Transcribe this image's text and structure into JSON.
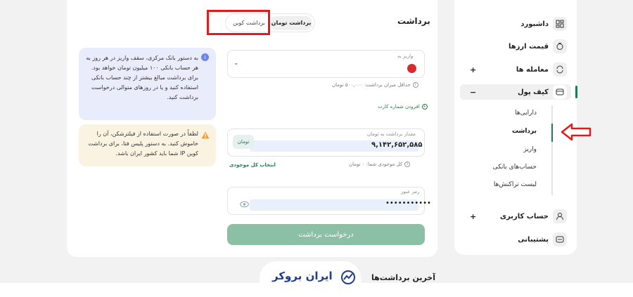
{
  "sidebar": {
    "items": [
      {
        "label": "داشبورد",
        "icon": "dashboard-icon"
      },
      {
        "label": "قیمت ارزها",
        "icon": "coin-icon"
      },
      {
        "label": "معامله ها",
        "icon": "trade-icon",
        "expand": "+"
      },
      {
        "label": "کیف پول",
        "icon": "wallet-icon",
        "expand": "−"
      },
      {
        "label": "حساب کاربری",
        "icon": "user-icon",
        "expand": "+"
      },
      {
        "label": "پشتیبانی",
        "icon": "support-icon"
      }
    ],
    "wallet_sub": [
      "دارایی‌ها",
      "برداشت",
      "واریز",
      "حساب‌های بانکی",
      "لیست تراکنش‌ها"
    ]
  },
  "main": {
    "title": "برداشت",
    "tabs": [
      "برداشت تومان",
      "برداشت کوین"
    ],
    "deposit_to_label": "واریز به",
    "min_withdraw_hint": "حداقل میزان برداشت: ۵۰۰,۰۰۰ تومان",
    "add_card": "افزودن شماره کارت",
    "amount_label": "مقدار برداشت به تومان",
    "amount_value": "۹,۱۴۲,۶۵۲,۵۸۵",
    "currency_badge": "تومان",
    "balance_hint": "کل موجودی شما: ۰ تومان",
    "select_all": "انتخاب کل موجودی",
    "password_label": "رمز عبور",
    "password_value": "•••••••••••",
    "submit": "درخواست برداشت",
    "info_text": "به دستور بانک مرکزی، سقف واریز در هر روز به هر حساب بانکی ۱۰۰ میلیون تومان خواهد بود. برای برداشت مبالغ بیشتر از چند حساب بانکی استفاده کنید و یا در روزهای متوالی درخواست برداشت کنید.",
    "warn_text": "لطفاً در صورت استفاده از فیلترشکن، آن را خاموش کنید. به دستور پلیس فتا، برای برداشت کوین IP شما باید کشور ایران باشد."
  },
  "recent": {
    "title": "آخرین برداشت‌ها"
  },
  "brand": {
    "logo": "ایران بروکر"
  },
  "colors": {
    "accent": "#1f7a4d",
    "submit": "#8cc0a6",
    "highlight": "#e01b1b"
  }
}
